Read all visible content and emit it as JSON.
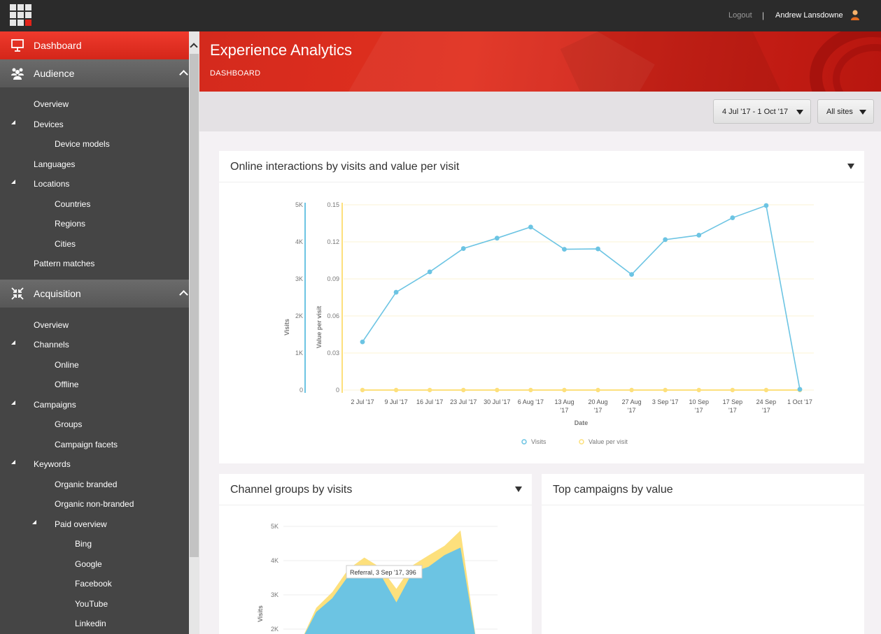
{
  "topbar": {
    "logout": "Logout",
    "separator": "|",
    "username": "Andrew Lansdowne"
  },
  "sidebar": {
    "dashboard": "Dashboard",
    "audience": {
      "label": "Audience",
      "items": [
        "Overview",
        "Devices",
        "Device models",
        "Languages",
        "Locations",
        "Countries",
        "Regions",
        "Cities",
        "Pattern matches"
      ]
    },
    "acquisition": {
      "label": "Acquisition",
      "items": [
        "Overview",
        "Channels",
        "Online",
        "Offline",
        "Campaigns",
        "Groups",
        "Campaign facets",
        "Keywords",
        "Organic branded",
        "Organic non-branded",
        "Paid overview",
        "Bing",
        "Google",
        "Facebook",
        "YouTube",
        "Linkedin"
      ]
    }
  },
  "header": {
    "title": "Experience Analytics",
    "breadcrumb": "DASHBOARD"
  },
  "filters": {
    "date_range": "4 Jul '17 - 1 Oct '17",
    "site": "All sites"
  },
  "colors": {
    "accent": "#e2231a",
    "visits": "#6cc4e3",
    "value_per_visit": "#fde07c"
  },
  "panels": {
    "interactions_title": "Online interactions by visits and value per visit",
    "channel_groups_title": "Channel groups by visits",
    "top_campaigns_title": "Top campaigns by value"
  },
  "chart_data": [
    {
      "type": "line",
      "title": "Online interactions by visits and value per visit",
      "xlabel": "Date",
      "ylabel": "Visits",
      "y2label": "Value per visit",
      "categories": [
        "2 Jul '17",
        "9 Jul '17",
        "16 Jul '17",
        "23 Jul '17",
        "30 Jul '17",
        "6 Aug '17",
        "13 Aug '17",
        "20 Aug '17",
        "27 Aug '17",
        "3 Sep '17",
        "10 Sep '17",
        "17 Sep '17",
        "24 Sep '17",
        "1 Oct '17"
      ],
      "category_lines": [
        [
          "2 Jul '17"
        ],
        [
          "9 Jul '17"
        ],
        [
          "16 Jul '17"
        ],
        [
          "23 Jul '17"
        ],
        [
          "30 Jul '17"
        ],
        [
          "6 Aug '17"
        ],
        [
          "13 Aug",
          "'17"
        ],
        [
          "20 Aug",
          "'17"
        ],
        [
          "27 Aug",
          "'17"
        ],
        [
          "3 Sep '17"
        ],
        [
          "10 Sep",
          "'17"
        ],
        [
          "17 Sep",
          "'17"
        ],
        [
          "24 Sep",
          "'17"
        ],
        [
          "1 Oct '17"
        ]
      ],
      "y_ticks": [
        "0",
        "1K",
        "2K",
        "3K",
        "4K",
        "5K"
      ],
      "y2_ticks": [
        "0",
        "0.03",
        "0.06",
        "0.09",
        "0.12",
        "0.15"
      ],
      "ylim": [
        0,
        5000
      ],
      "y2lim": [
        0,
        0.15
      ],
      "series": [
        {
          "name": "Visits",
          "axis": "left",
          "values": [
            1300,
            2640,
            3190,
            3820,
            4100,
            4400,
            3800,
            3810,
            3120,
            4060,
            4180,
            4650,
            4980,
            20
          ]
        },
        {
          "name": "Value per visit",
          "axis": "right",
          "values": [
            0,
            0,
            0,
            0,
            0,
            0,
            0,
            0,
            0,
            0,
            0,
            0,
            0,
            0
          ]
        }
      ],
      "legend": "bottom",
      "grid": true
    },
    {
      "type": "area",
      "title": "Channel groups by visits",
      "ylabel": "Visits",
      "y_ticks": [
        "2K",
        "3K",
        "4K",
        "5K"
      ],
      "ylim": [
        1600,
        5000
      ],
      "x": [
        0,
        1,
        2,
        3,
        4,
        5,
        6,
        7,
        8,
        9,
        10,
        11
      ],
      "series": [
        {
          "name": "Visits",
          "values": [
            1600,
            2500,
            2900,
            3550,
            3810,
            3600,
            2780,
            3660,
            3820,
            4160,
            4380,
            1600
          ]
        },
        {
          "name": "Referral",
          "values": [
            0,
            120,
            180,
            200,
            280,
            200,
            396,
            200,
            330,
            270,
            500,
            0
          ]
        }
      ],
      "tooltip": "Referral, 3 Sep '17, 396"
    }
  ]
}
